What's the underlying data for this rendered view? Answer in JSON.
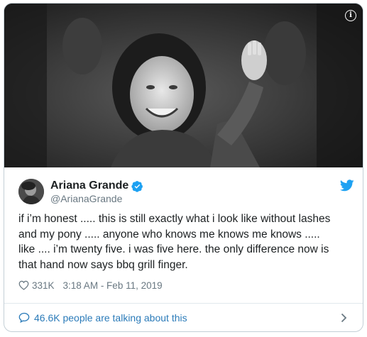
{
  "media": {
    "alt": "black and white photo of a smiling child waving",
    "info_icon": "info-icon"
  },
  "author": {
    "display_name": "Ariana Grande",
    "handle": "@ArianaGrande",
    "verified": true
  },
  "tweet": {
    "text": "if i’m honest ..... this is still exactly what i look like without lashes\nand my pony ..... anyone who knows me knows me knows .....\nlike .... i’m twenty five. i was five here. the only difference now is\nthat hand now says bbq grill finger."
  },
  "meta": {
    "likes": "331K",
    "timestamp": "3:18 AM - Feb 11, 2019"
  },
  "footer": {
    "label": "46.6K people are talking about this"
  },
  "colors": {
    "accent": "#1da1f2",
    "link": "#2b7bb9",
    "muted": "#697882",
    "border": "#c4cfd6"
  }
}
